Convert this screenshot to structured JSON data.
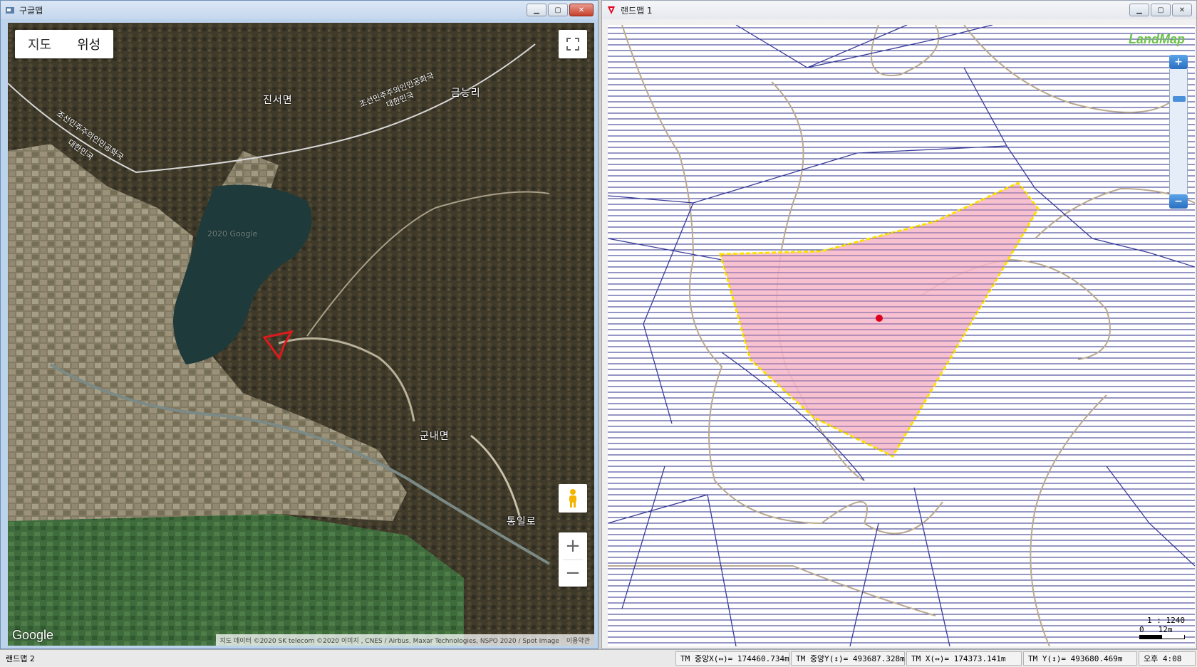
{
  "google_window": {
    "title": "구글맵",
    "map_types": [
      "지도",
      "위성"
    ],
    "places": {
      "jinseo": "진서면",
      "geumneung": "금능리",
      "gunnae": "군내면",
      "tongil": "통일로"
    },
    "border_labels": {
      "a1": "조선민주주의인민공화국",
      "a2": "대한민국",
      "b1": "조선민주주의인민공화국",
      "b2": "대한민국"
    },
    "watermark": "2020 Google",
    "logo": "Google",
    "attribution": "지도 데이터 ©2020 SK telecom ©2020 이미지 , CNES / Airbus, Maxar Technologies, NSPO 2020 / Spot Image",
    "terms": "이용약관",
    "zoom_in": "+",
    "zoom_out": "−"
  },
  "landmap_window": {
    "title": "랜드맵 1",
    "logo": "LandMap",
    "zoom_in": "+",
    "zoom_out": "−",
    "scale_ratio": "1 : 1240",
    "scale_min": "0",
    "scale_max": "12m",
    "colors": {
      "parcel_fill": "#f7b6c8",
      "parcel_outline": "#ffe100",
      "hatch": "#2b2d8a",
      "contour": "#b9a98f",
      "marker": "#e0001a"
    }
  },
  "status_bar": {
    "left": "랜드맵 2",
    "tm_center_x": "TM 중앙X(↔)= 174460.734m",
    "tm_center_y": "TM 중앙Y(↕)= 493687.328m",
    "tm_x": "TM X(↔)= 174373.141m",
    "tm_y": "TM Y(↕)= 493680.469m",
    "clock": "오후 4:08"
  }
}
